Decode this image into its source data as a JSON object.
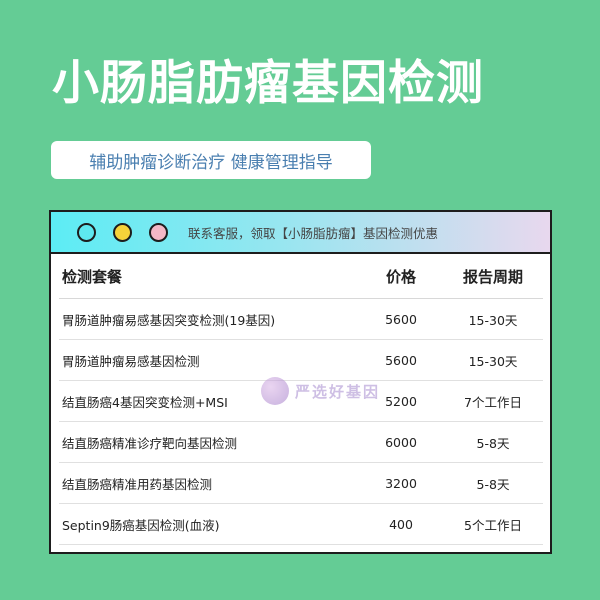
{
  "title": "小肠脂肪瘤基因检测",
  "subtitle": "辅助肿瘤诊断治疗 健康管理指导",
  "window": {
    "banner": "联系客服，领取【小肠脂肪瘤】基因检测优惠",
    "dots": [
      {
        "name": "cyan-window-dot",
        "color": "#5ee8f0"
      },
      {
        "name": "yellow-window-dot",
        "color": "#f6d33a"
      },
      {
        "name": "pink-window-dot",
        "color": "#f4b8c6"
      }
    ]
  },
  "table": {
    "headers": [
      "检测套餐",
      "价格",
      "报告周期"
    ],
    "rows": [
      [
        "胃肠道肿瘤易感基因突变检测(19基因)",
        "5600",
        "15-30天"
      ],
      [
        "胃肠道肿瘤易感基因检测",
        "5600",
        "15-30天"
      ],
      [
        "结直肠癌4基因突变检测+MSI",
        "5200",
        "7个工作日"
      ],
      [
        "结直肠癌精准诊疗靶向基因检测",
        "6000",
        "5-8天"
      ],
      [
        "结直肠癌精准用药基因检测",
        "3200",
        "5-8天"
      ],
      [
        "Septin9肠癌基因检测(血液)",
        "400",
        "5个工作日"
      ]
    ]
  },
  "watermark": "严选好基因",
  "colors": {
    "background": "#64cc95",
    "subtitle_text": "#4a7fb0"
  }
}
